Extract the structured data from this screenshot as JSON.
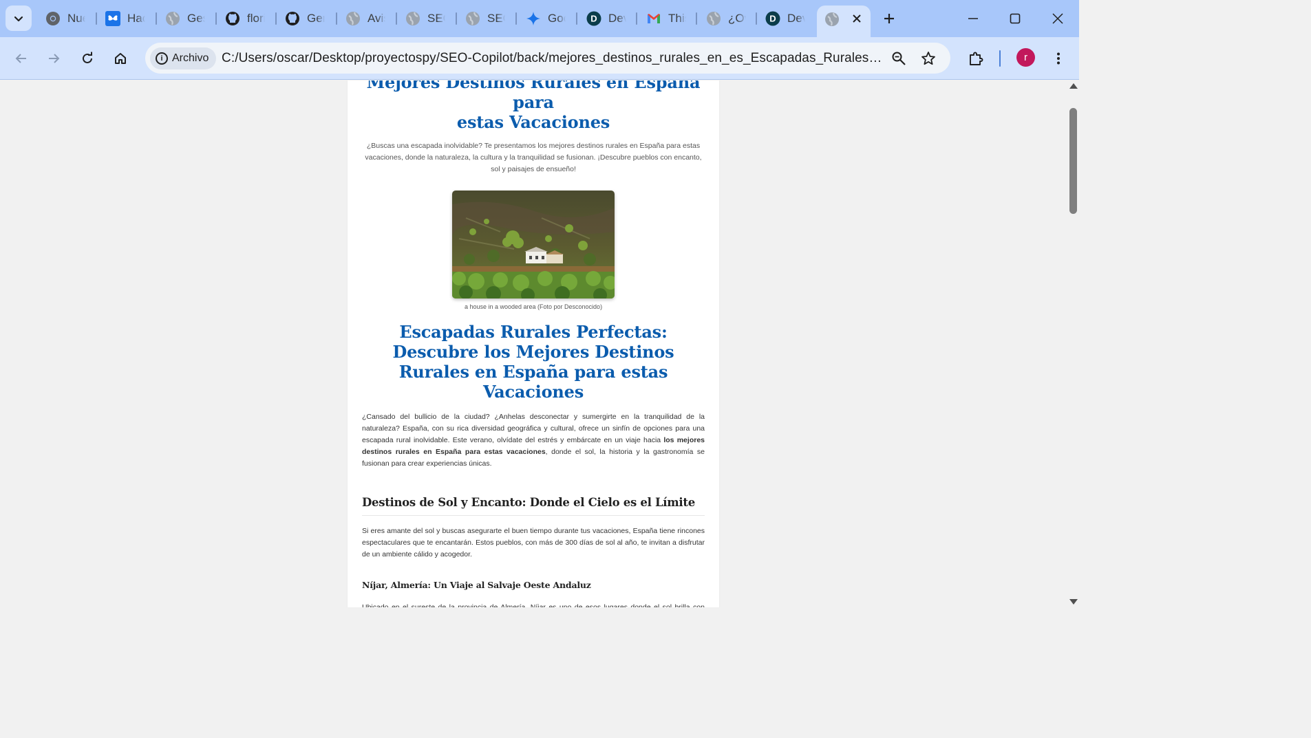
{
  "browser": {
    "tabs": [
      {
        "title": "Nue",
        "icon": "chrome-icon"
      },
      {
        "title": "Hac",
        "icon": "butterfly-icon"
      },
      {
        "title": "Ges",
        "icon": "globe-icon"
      },
      {
        "title": "flori",
        "icon": "github-icon"
      },
      {
        "title": "Gen",
        "icon": "github-icon"
      },
      {
        "title": "Avis",
        "icon": "globe-icon"
      },
      {
        "title": "SEO",
        "icon": "globe-icon"
      },
      {
        "title": "SEO",
        "icon": "globe-icon"
      },
      {
        "title": "Goo",
        "icon": "gemini-icon"
      },
      {
        "title": "Dev",
        "icon": "devto-icon"
      },
      {
        "title": "This",
        "icon": "gmail-icon"
      },
      {
        "title": "¿Ov",
        "icon": "globe-icon"
      },
      {
        "title": "Dev",
        "icon": "devto-icon"
      }
    ],
    "security_chip": "Archivo",
    "url": "C:/Users/oscar/Desktop/proyectospy/SEO-Copilot/back/mejores_destinos_rurales_en_es_Escapadas_Rurales_Perfectas_Descubre_los_Mejores_Destinos_Rurales_en_España_para_estas_Vacaciones.html",
    "profile_initial": "r",
    "colors": {
      "tabstrip": "#a8c7fa",
      "toolbar": "#d3e3fd",
      "avatar": "#c2185b",
      "heading": "#0b5cad"
    }
  },
  "article": {
    "title_lines": [
      "Mejores Destinos Rurales en España para",
      "estas Vacaciones"
    ],
    "intro": "¿Buscas una escapada inolvidable? Te presentamos los mejores destinos rurales en España para estas vacaciones, donde la naturaleza, la cultura y la tranquilidad se fusionan. ¡Descubre pueblos con encanto, sol y paisajes de ensueño!",
    "image_caption": "a house in a wooded area (Foto por Desconocido)",
    "section_title": "Escapadas Rurales Perfectas: Descubre los Mejores Destinos Rurales en España para estas Vacaciones",
    "lead_before": "¿Cansado del bullicio de la ciudad? ¿Anhelas desconectar y sumergirte en la tranquilidad de la naturaleza? España, con su rica diversidad geográfica y cultural, ofrece un sinfín de opciones para una escapada rural inolvidable. Este verano, olvídate del estrés y embárcate en un viaje hacia ",
    "lead_bold": "los mejores destinos rurales en España para estas vacaciones",
    "lead_after": ", donde el sol, la historia y la gastronomía se fusionan para crear experiencias únicas.",
    "h2": "Destinos de Sol y Encanto: Donde el Cielo es el Límite",
    "p2": "Si eres amante del sol y buscas asegurarte el buen tiempo durante tus vacaciones, España tiene rincones espectaculares que te encantarán. Estos pueblos, con más de 300 días de sol al año, te invitan a disfrutar de un ambiente cálido y acogedor.",
    "h3": "Níjar, Almería: Un Viaje al Salvaje Oeste Andaluz",
    "p3": "Ubicado en el sureste de la provincia de Almería, Níjar es uno de esos lugares donde el sol brilla con intensidad. Su paisaje, que recuerda a un western, y su cielo azul, son el escenario perfecto para unas vacaciones sin preocupaciones. Explora el Parque Natural de Cabo de Gata-Níjar, un espacio protegido con playas vírgenes,"
  }
}
